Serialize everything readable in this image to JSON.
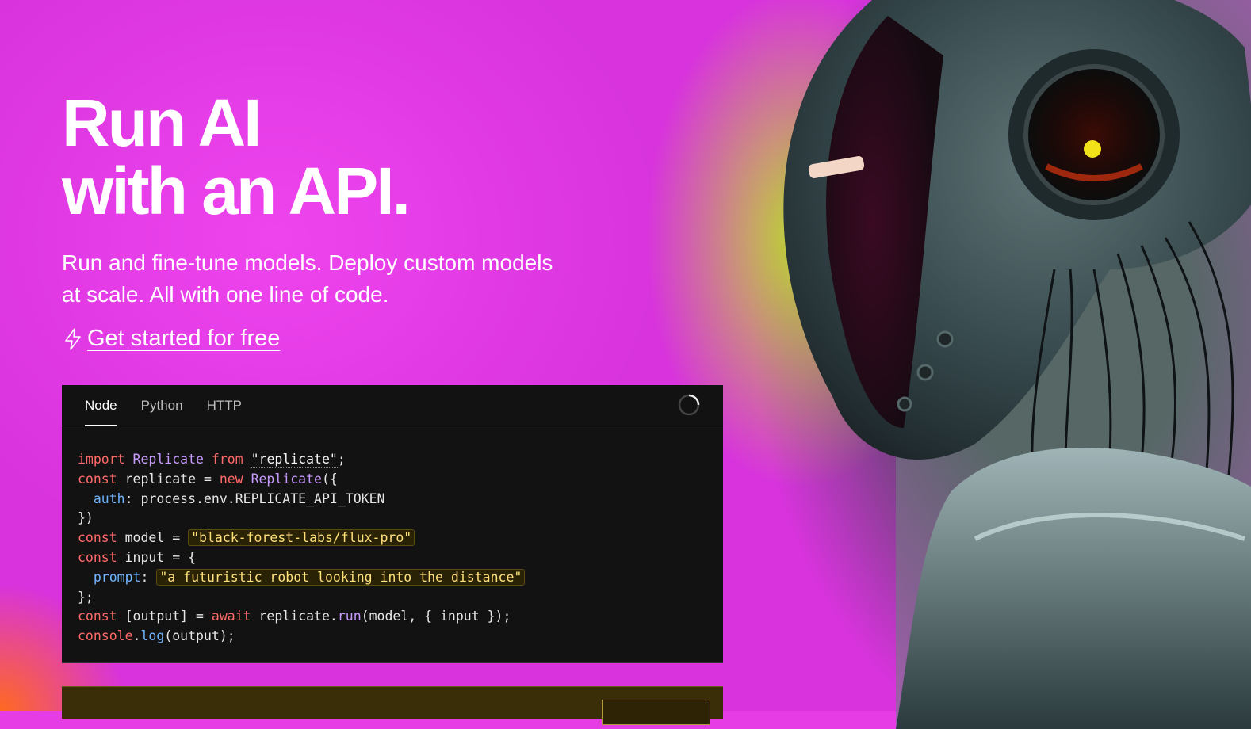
{
  "hero": {
    "title_line1": "Run AI",
    "title_line2": "with an API.",
    "subtitle": "Run and fine-tune models. Deploy custom models at scale. All with one line of code.",
    "cta_label": "Get started for free",
    "cta_icon": "lightning-icon"
  },
  "code_panel": {
    "tabs": [
      "Node",
      "Python",
      "HTTP"
    ],
    "active_tab": "Node",
    "loading_icon": "spinner-icon",
    "lines": {
      "l1_import": "import",
      "l1_class": "Replicate",
      "l1_from": "from",
      "l1_module": "\"replicate\"",
      "l1_end": ";",
      "l2_const": "const",
      "l2_name": " replicate = ",
      "l2_new": "new",
      "l2_class": "Replicate",
      "l2_end": "({",
      "l3_prop": "auth",
      "l3_rest": ": process.env.REPLICATE_API_TOKEN",
      "l4": "})",
      "l5_const": "const",
      "l5_name": " model = ",
      "l5_value": "\"black-forest-labs/flux-pro\"",
      "l6_const": "const",
      "l6_rest": " input = {",
      "l7_prop": "prompt",
      "l7_colon": ": ",
      "l7_value": "\"a futuristic robot looking into the distance\"",
      "l8": "};",
      "l9_const": "const",
      "l9_mid": " [output] = ",
      "l9_await": "await",
      "l9_obj": " replicate.",
      "l9_fn": "run",
      "l9_args": "(model, { input });",
      "l10_obj": "console",
      "l10_dot": ".",
      "l10_fn": "log",
      "l10_args": "(output);"
    }
  },
  "colors": {
    "background_magenta": "#e63ce6",
    "code_bg": "#121212",
    "keyword": "#ff6a6a",
    "class": "#c89bff",
    "property": "#6fb5ff",
    "string": "#ffe07a"
  }
}
